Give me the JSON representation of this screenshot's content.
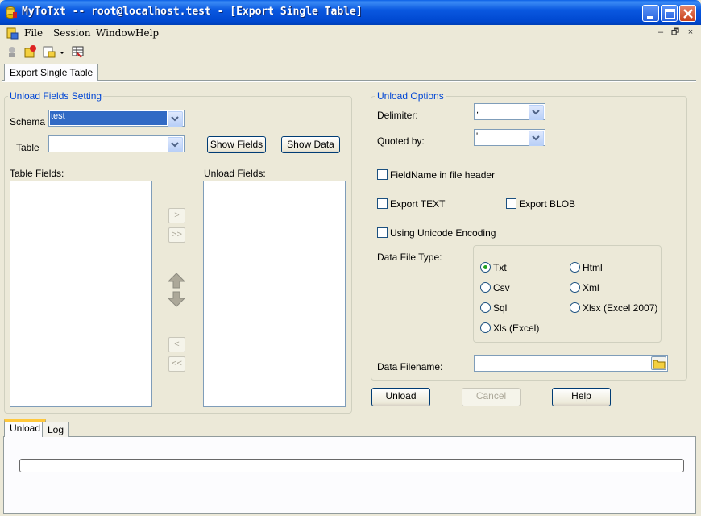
{
  "window": {
    "title": "MyToTxt -- root@localhost.test - [Export Single Table]"
  },
  "menu": {
    "items": [
      "File",
      "Session",
      "Window",
      "Help"
    ],
    "mdi": [
      "–",
      "🗗",
      "×"
    ]
  },
  "tabs": {
    "top": [
      "Export Single Table"
    ],
    "bottom": [
      "Unload",
      "Log"
    ]
  },
  "unload_fields": {
    "legend": "Unload Fields Setting",
    "schema_label": "Schema",
    "schema_value": "test",
    "table_label": "Table",
    "table_value": "",
    "show_fields": "Show Fields",
    "show_data": "Show Data",
    "table_fields_label": "Table Fields:",
    "unload_fields_label": "Unload Fields:",
    "move": [
      ">",
      ">>",
      "<",
      "<<"
    ]
  },
  "unload_options": {
    "legend": "Unload Options",
    "delimiter_label": "Delimiter:",
    "delimiter_value": ",",
    "quoted_label": "Quoted by:",
    "quoted_value": "'",
    "fieldname_header": "FieldName in file header",
    "export_text": "Export TEXT",
    "export_blob": "Export BLOB",
    "unicode": "Using Unicode Encoding",
    "data_file_type": "Data File Type:",
    "types": [
      "Txt",
      "Html",
      "Csv",
      "Xml",
      "Sql",
      "Xlsx (Excel 2007)",
      "Xls (Excel)"
    ],
    "selected_type": "Txt",
    "data_filename": "Data Filename:",
    "filename_value": ""
  },
  "actions": {
    "unload": "Unload",
    "cancel": "Cancel",
    "help": "Help"
  },
  "progress": {
    "value": 0
  },
  "colors": {
    "title_bar": "#0a58e0",
    "legend_text": "#0046d5",
    "window_bg": "#ece9d8"
  }
}
